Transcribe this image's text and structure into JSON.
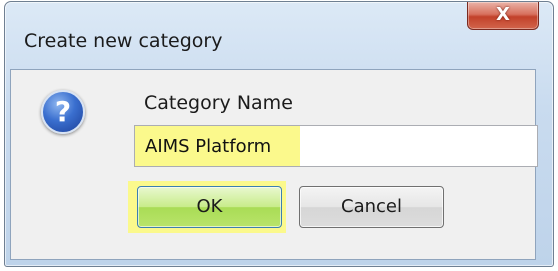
{
  "window": {
    "title": "Create new category",
    "close_label": "X"
  },
  "dialog": {
    "icon": "question-icon",
    "icon_glyph": "?",
    "field_label": "Category Name",
    "field_value": "AIMS Platform",
    "ok_label": "OK",
    "cancel_label": "Cancel"
  },
  "colors": {
    "highlight": "#fbf98c",
    "ok_button": "#b9e46a",
    "close_button": "#c2412a"
  }
}
